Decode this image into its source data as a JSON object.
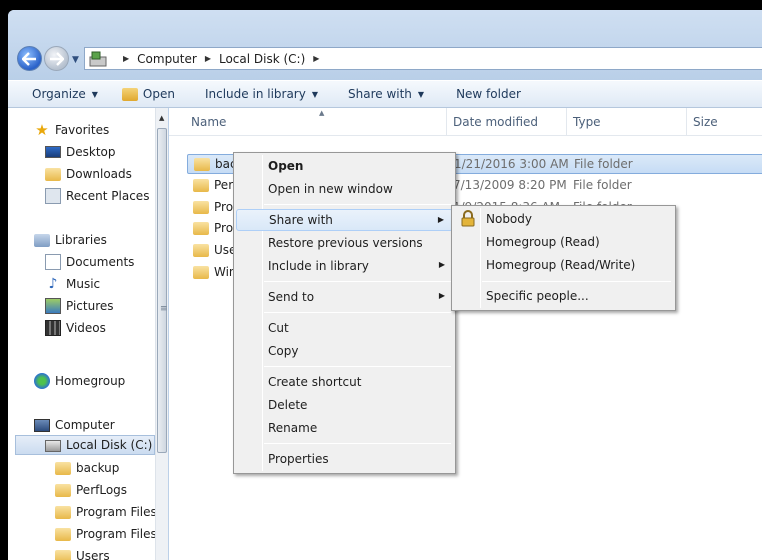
{
  "address": {
    "crumbs": [
      "Computer",
      "Local Disk (C:)"
    ]
  },
  "toolbar": {
    "organize": "Organize",
    "open": "Open",
    "include_in_library": "Include in library",
    "share_with": "Share with",
    "new_folder": "New folder"
  },
  "navpane": {
    "favorites": "Favorites",
    "desktop": "Desktop",
    "downloads": "Downloads",
    "recent_places": "Recent Places",
    "libraries": "Libraries",
    "documents": "Documents",
    "music": "Music",
    "pictures": "Pictures",
    "videos": "Videos",
    "homegroup": "Homegroup",
    "computer": "Computer",
    "local_disk": "Local Disk (C:)",
    "folders": [
      "backup",
      "PerfLogs",
      "Program Files",
      "Program Files (",
      "Users"
    ]
  },
  "columns": {
    "name": "Name",
    "date_modified": "Date modified",
    "type": "Type",
    "size": "Size"
  },
  "files": [
    {
      "name": "back",
      "date": "1/21/2016 3:00 AM",
      "type": "File folder"
    },
    {
      "name": "Perf",
      "date": "7/13/2009 8:20 PM",
      "type": "File folder"
    },
    {
      "name": "Prog",
      "date": "1/9/2015 8:36 AM",
      "type": "File folder"
    },
    {
      "name": "Prog",
      "date": "",
      "type": ""
    },
    {
      "name": "User",
      "date": "",
      "type": ""
    },
    {
      "name": "Win",
      "date": "",
      "type": ""
    }
  ],
  "context_menu": {
    "open": "Open",
    "open_new_window": "Open in new window",
    "share_with": "Share with",
    "restore_previous": "Restore previous versions",
    "include_in_library": "Include in library",
    "send_to": "Send to",
    "cut": "Cut",
    "copy": "Copy",
    "create_shortcut": "Create shortcut",
    "delete": "Delete",
    "rename": "Rename",
    "properties": "Properties"
  },
  "share_submenu": {
    "nobody": "Nobody",
    "homegroup_read": "Homegroup (Read)",
    "homegroup_readwrite": "Homegroup (Read/Write)",
    "specific_people": "Specific people..."
  }
}
